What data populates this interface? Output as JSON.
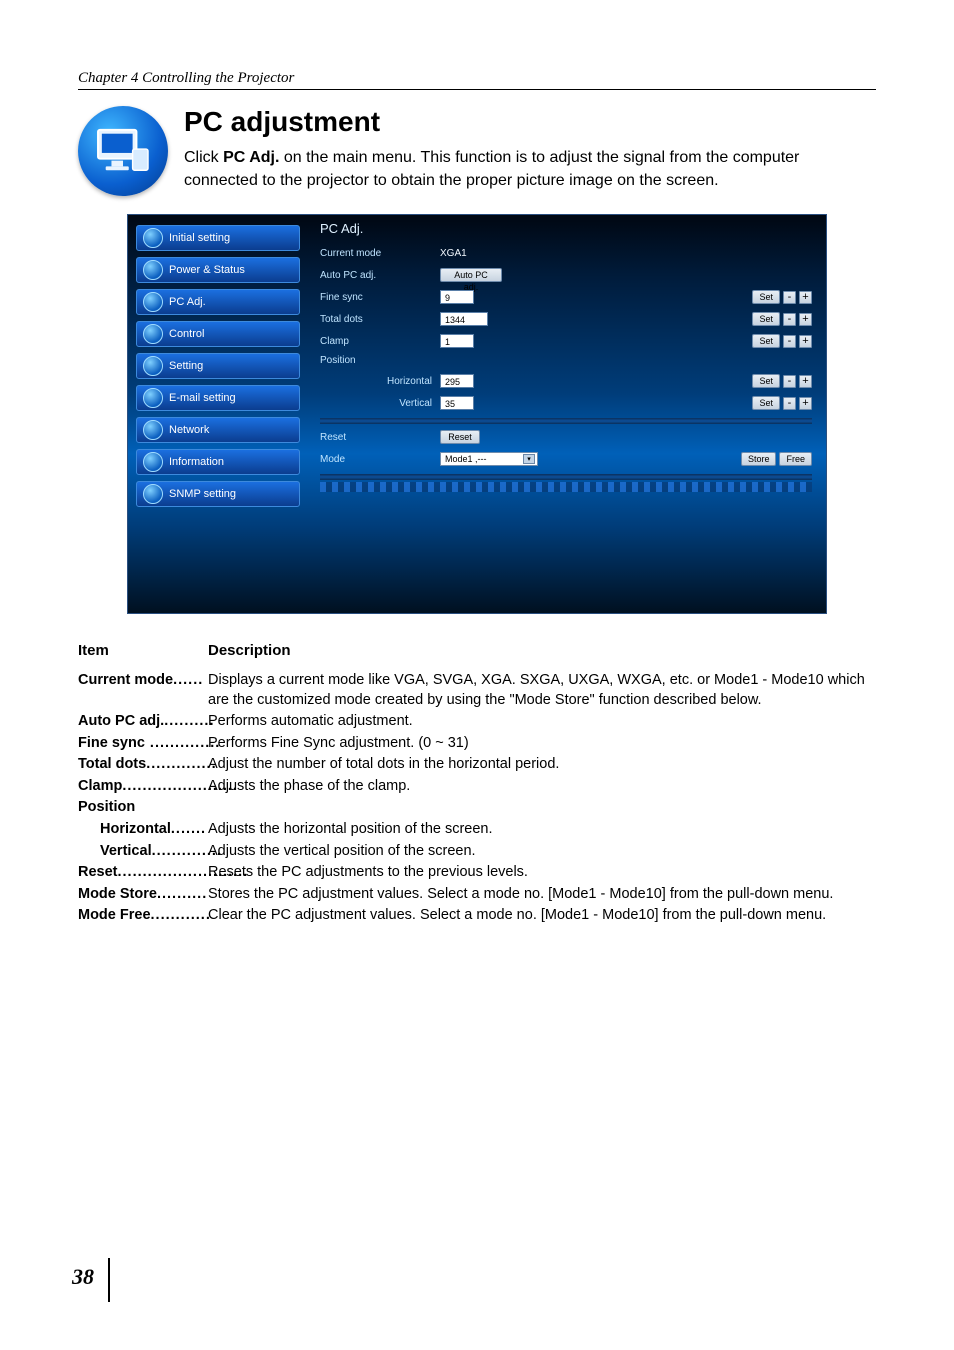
{
  "chapter_header": "Chapter 4 Controlling the Projector",
  "title": "PC adjustment",
  "intro_pre": "Click ",
  "intro_bold": "PC Adj.",
  "intro_post": " on the main menu. This function is to adjust the signal from the computer connected to the projector to obtain the proper picture image on the screen.",
  "sidebar": {
    "items": [
      "Initial setting",
      "Power & Status",
      "PC Adj.",
      "Control",
      "Setting",
      "E-mail setting",
      "Network",
      "Information",
      "SNMP setting"
    ]
  },
  "panel": {
    "title": "PC Adj.",
    "rows": {
      "current_mode_label": "Current mode",
      "current_mode_value": "XGA1",
      "auto_pc_label": "Auto PC adj.",
      "auto_pc_btn": "Auto PC adj.",
      "fine_sync_label": "Fine sync",
      "fine_sync_value": "9",
      "total_dots_label": "Total dots",
      "total_dots_value": "1344",
      "clamp_label": "Clamp",
      "clamp_value": "1",
      "position_label": "Position",
      "horizontal_label": "Horizontal",
      "horizontal_value": "295",
      "vertical_label": "Vertical",
      "vertical_value": "35",
      "reset_label": "Reset",
      "reset_btn": "Reset",
      "mode_label": "Mode",
      "mode_value": "Mode1 ,---",
      "store_btn": "Store",
      "free_btn": "Free",
      "set_btn": "Set",
      "minus": "-",
      "plus": "+"
    }
  },
  "desc": {
    "header_item": "Item",
    "header_desc": "Description",
    "current_mode_k": "Current mode",
    "current_mode_v": "Displays a current mode like VGA, SVGA, XGA. SXGA, UXGA, WXGA, etc. or Mode1 - Mode10 which are the customized mode created by using the \"Mode Store\" function described below.",
    "auto_pc_k": "Auto PC adj.",
    "auto_pc_v": "Performs automatic adjustment.",
    "fine_sync_k": "Fine sync",
    "fine_sync_v": "Performs Fine Sync adjustment. (0 ~ 31)",
    "total_dots_k": "Total dots",
    "total_dots_v": "Adjust the number of total dots in the horizontal period.",
    "clamp_k": "Clamp",
    "clamp_v": "Adjusts the phase of the clamp.",
    "position_k": "Position",
    "horizontal_k": "Horizontal",
    "horizontal_v": "Adjusts the horizontal position of the screen.",
    "vertical_k": "Vertical",
    "vertical_v": "Adjusts the vertical position of the screen.",
    "reset_k": "Reset",
    "reset_v": "Resets the PC adjustments to the previous levels.",
    "mode_store_k": "Mode Store",
    "mode_store_v": "Stores the PC adjustment values. Select a mode no. [Mode1 - Mode10] from the pull-down menu.",
    "mode_free_k": "Mode Free",
    "mode_free_v": "Clear the PC adjustment values. Select a mode no.  [Mode1 - Mode10] from the pull-down menu."
  },
  "page_number": "38"
}
